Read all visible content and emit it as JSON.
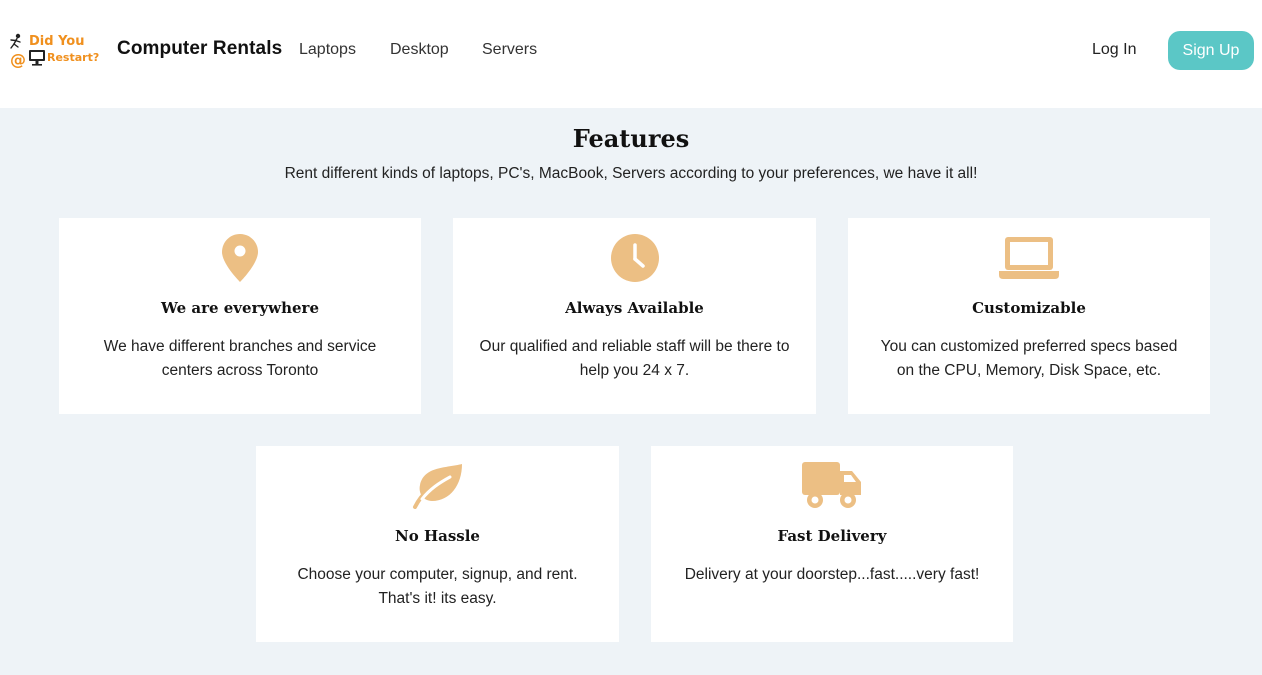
{
  "navbar": {
    "logo": {
      "line1": "Did You",
      "line2": "Restart?",
      "at_symbol": "@",
      "icons": [
        "runner-icon",
        "monitor-icon"
      ]
    },
    "brand": "Computer Rentals",
    "links": [
      {
        "label": "Laptops"
      },
      {
        "label": "Desktop"
      },
      {
        "label": "Servers"
      }
    ],
    "login_label": "Log In",
    "signup_label": "Sign Up"
  },
  "features": {
    "title": "Features",
    "subtitle": "Rent different kinds of laptops, PC's, MacBook, Servers according to your preferences, we have it all!",
    "cards": [
      {
        "icon": "location-pin-icon",
        "title": "We are everywhere",
        "text": "We have different branches and service centers across Toronto"
      },
      {
        "icon": "clock-icon",
        "title": "Always Available",
        "text": "Our qualified and reliable staff will be there to help you 24 x 7."
      },
      {
        "icon": "laptop-icon",
        "title": "Customizable",
        "text": "You can customized preferred specs based on the CPU, Memory, Disk Space, etc."
      },
      {
        "icon": "leaf-icon",
        "title": "No Hassle",
        "text": "Choose your computer, signup, and rent. That's it! its easy."
      },
      {
        "icon": "truck-icon",
        "title": "Fast Delivery",
        "text": "Delivery at your doorstep...fast.....very fast!"
      }
    ]
  },
  "colors": {
    "accent": "#5bc7c6",
    "icon": "#ecbf84",
    "logo_orange": "#f0901e",
    "section_bg": "#eef3f7"
  }
}
